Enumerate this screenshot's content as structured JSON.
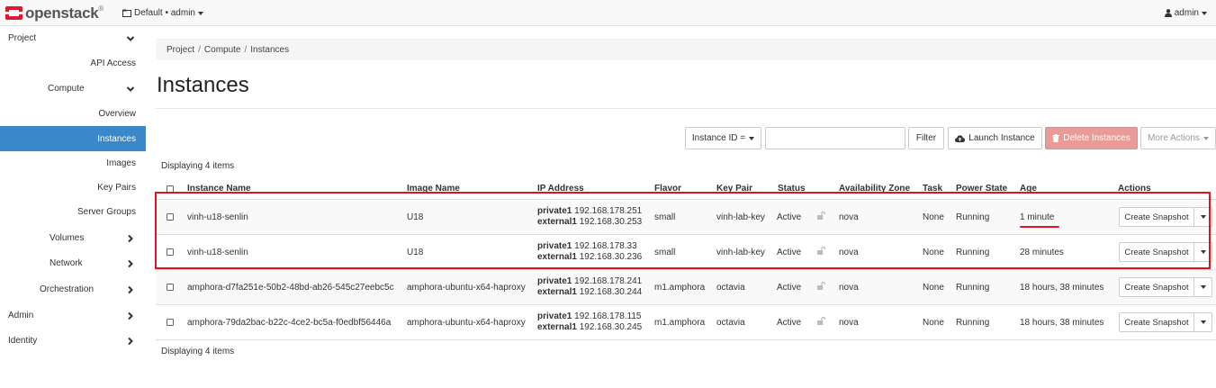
{
  "navbar": {
    "brand": "openstack",
    "brand_tm": "®",
    "project_selector": "Default • admin",
    "user": "admin"
  },
  "sidebar": {
    "items": [
      {
        "label": "Project",
        "level": 0,
        "icon": "chevron-down-icon"
      },
      {
        "label": "API Access",
        "level": 2
      },
      {
        "label": "Compute",
        "level": 1,
        "icon": "chevron-down-icon"
      },
      {
        "label": "Overview",
        "level": 2
      },
      {
        "label": "Instances",
        "level": 2,
        "active": true
      },
      {
        "label": "Images",
        "level": 2
      },
      {
        "label": "Key Pairs",
        "level": 2
      },
      {
        "label": "Server Groups",
        "level": 2
      },
      {
        "label": "Volumes",
        "level": 1,
        "icon": "chevron-right-icon"
      },
      {
        "label": "Network",
        "level": 1,
        "icon": "chevron-right-icon"
      },
      {
        "label": "Orchestration",
        "level": 1,
        "icon": "chevron-right-icon"
      },
      {
        "label": "Admin",
        "level": 0,
        "icon": "chevron-right-icon"
      },
      {
        "label": "Identity",
        "level": 0,
        "icon": "chevron-right-icon"
      }
    ]
  },
  "breadcrumb": [
    "Project",
    "Compute",
    "Instances"
  ],
  "breadcrumb_sep": "/",
  "page_title": "Instances",
  "toolbar": {
    "filter_field": "Instance ID =",
    "filter_value": "",
    "filter_button": "Filter",
    "launch_button": "Launch Instance",
    "delete_button": "Delete Instances",
    "more_actions": "More Actions"
  },
  "displaying_top": "Displaying 4 items",
  "displaying_bottom": "Displaying 4 items",
  "table": {
    "columns": [
      "Instance Name",
      "Image Name",
      "IP Address",
      "Flavor",
      "Key Pair",
      "Status",
      "Availability Zone",
      "Task",
      "Power State",
      "Age",
      "Actions"
    ],
    "rows": [
      {
        "name": "vinh-u18-senlin",
        "image": "U18",
        "ip1_label": "private1",
        "ip1": "192.168.178.251",
        "ip2_label": "external1",
        "ip2": "192.168.30.253",
        "flavor": "small",
        "keypair": "vinh-lab-key",
        "status": "Active",
        "az": "nova",
        "task": "None",
        "power": "Running",
        "age": "1 minute",
        "action": "Create Snapshot"
      },
      {
        "name": "vinh-u18-senlin",
        "image": "U18",
        "ip1_label": "private1",
        "ip1": "192.168.178.33",
        "ip2_label": "external1",
        "ip2": "192.168.30.236",
        "flavor": "small",
        "keypair": "vinh-lab-key",
        "status": "Active",
        "az": "nova",
        "task": "None",
        "power": "Running",
        "age": "28 minutes",
        "action": "Create Snapshot"
      },
      {
        "name": "amphora-d7fa251e-50b2-48bd-ab26-545c27eebc5c",
        "image": "amphora-ubuntu-x64-haproxy",
        "ip1_label": "private1",
        "ip1": "192.168.178.241",
        "ip2_label": "external1",
        "ip2": "192.168.30.244",
        "flavor": "m1.amphora",
        "keypair": "octavia",
        "status": "Active",
        "az": "nova",
        "task": "None",
        "power": "Running",
        "age": "18 hours, 38 minutes",
        "action": "Create Snapshot"
      },
      {
        "name": "amphora-79da2bac-b22c-4ce2-bc5a-f0edbf56446a",
        "image": "amphora-ubuntu-x64-haproxy",
        "ip1_label": "private1",
        "ip1": "192.168.178.115",
        "ip2_label": "external1",
        "ip2": "192.168.30.245",
        "flavor": "m1.amphora",
        "keypair": "octavia",
        "status": "Active",
        "az": "nova",
        "task": "None",
        "power": "Running",
        "age": "18 hours, 38 minutes",
        "action": "Create Snapshot"
      }
    ]
  },
  "colors": {
    "accent": "#3a87c9",
    "link": "#2a6ebb",
    "danger": "#e99b98",
    "annotation": "#e0141e",
    "brand_red": "#da1a32"
  }
}
